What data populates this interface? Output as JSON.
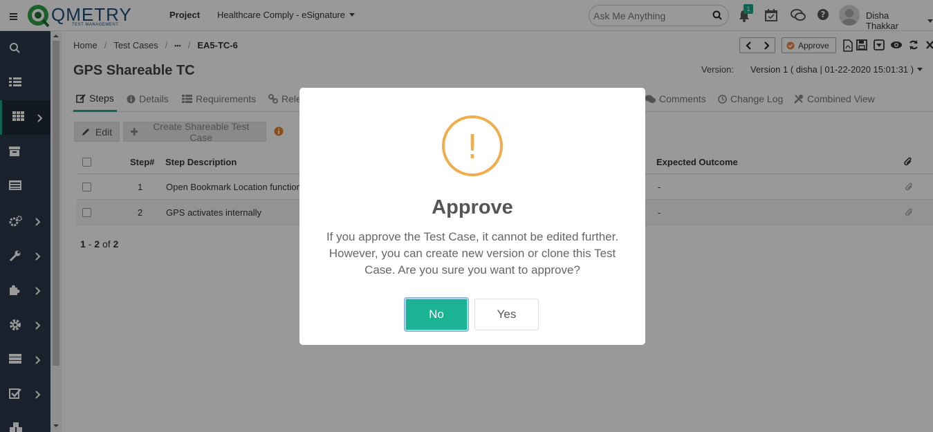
{
  "app": {
    "logo_text": "QMETRY",
    "logo_subtext": "TEST MANAGEMENT"
  },
  "header": {
    "project_label": "Project",
    "project_name": "Healthcare Comply - eSignature",
    "search_placeholder": "Ask Me Anything",
    "notification_count": "1",
    "username": "Disha Thakkar"
  },
  "breadcrumb": {
    "home": "Home",
    "test_cases": "Test Cases",
    "ellipsis": "•••",
    "current": "EA5-TC-6"
  },
  "page": {
    "title": "GPS Shareable TC",
    "version_label": "Version:",
    "version_value": "Version 1 ( disha | 01-22-2020 15:01:31 )"
  },
  "toolbar": {
    "approve_label": "Approve"
  },
  "tabs": [
    {
      "label": "Steps"
    },
    {
      "label": "Details"
    },
    {
      "label": "Requirements"
    },
    {
      "label": "Relea"
    },
    {
      "label": "Comments"
    },
    {
      "label": "Change Log"
    },
    {
      "label": "Combined View"
    }
  ],
  "actions": {
    "edit_label": "Edit",
    "create_label": "Create Shareable Test Case"
  },
  "grid": {
    "columns": {
      "step": "Step#",
      "description": "Step Description",
      "expected": "Expected Outcome"
    },
    "rows": [
      {
        "step": "1",
        "description": "Open Bookmark Location function",
        "expected": "-"
      },
      {
        "step": "2",
        "description": "GPS activates internally",
        "expected": "-"
      }
    ]
  },
  "pager": {
    "from": "1",
    "dash": "-",
    "to": "2",
    "of": "of",
    "total": "2"
  },
  "modal": {
    "icon_glyph": "!",
    "title": "Approve",
    "message": "If you approve the Test Case, it cannot be edited further. However, you can create new version or clone this Test Case. Are you sure you want to approve?",
    "no_label": "No",
    "yes_label": "Yes"
  },
  "colors": {
    "accent": "#1ab394",
    "sidebar": "#2b3a4a",
    "warning": "#f0ad4e",
    "brand": "#1f4b7a"
  }
}
